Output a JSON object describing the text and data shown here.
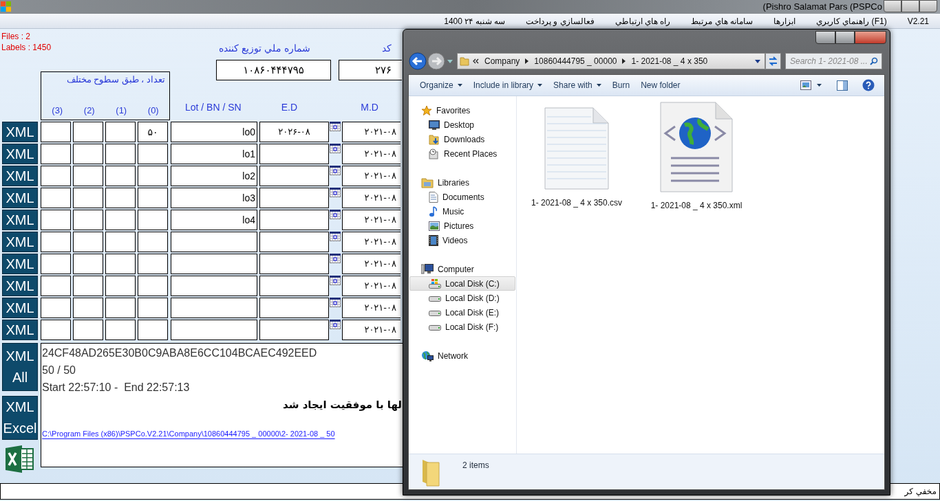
{
  "app": {
    "title": "(Pishro Salamat Pars (PSPCo",
    "menu": [
      "V2.21",
      "(F1) راهنماي كاربري",
      "ابزارها",
      "سامانه هاي مرتبط",
      "راه هاي ارتباطي",
      "فعالسازي و پرداخت",
      "سه شنبه ۲۴ 1400"
    ],
    "stats": [
      "Files : 2",
      "Labels : 1450"
    ],
    "distributor_label": "شماره ملي توزيع كننده",
    "code_label": "كد",
    "distributor_id": "۱۰۸۶۰۴۴۴۷۹۵",
    "code": "۲۷۶",
    "levels_caption": "تعداد ، طبق سطوح مختلف",
    "level_headers": [
      "(3)",
      "(2)",
      "(1)",
      "(0)"
    ],
    "columns": [
      "Lot / BN / SN",
      "E.D",
      "M.D"
    ],
    "rows": [
      {
        "button": "XML",
        "count_0": "۵۰",
        "lot": "lo0",
        "ed": "۲۰۲۶-۰۸",
        "md": "۲۰۲۱-۰۸"
      },
      {
        "button": "XML",
        "lot": "lo1",
        "md": "۲۰۲۱-۰۸"
      },
      {
        "button": "XML",
        "lot": "lo2",
        "md": "۲۰۲۱-۰۸"
      },
      {
        "button": "XML",
        "lot": "lo3",
        "md": "۲۰۲۱-۰۸"
      },
      {
        "button": "XML",
        "lot": "lo4",
        "md": "۲۰۲۱-۰۸"
      },
      {
        "button": "XML",
        "md": "۲۰۲۱-۰۸"
      },
      {
        "button": "XML",
        "md": "۲۰۲۱-۰۸"
      },
      {
        "button": "XML",
        "md": "۲۰۲۱-۰۸"
      },
      {
        "button": "XML",
        "md": "۲۰۲۱-۰۸"
      },
      {
        "button": "XML",
        "md": "۲۰۲۱-۰۸"
      }
    ],
    "side_buttons": [
      "XML All",
      "XML Excel"
    ],
    "output": {
      "lines": [
        "24CF48AD265E30B0C9ABA8E6CC104BCAEC492EED",
        "50 / 50",
        "Start 22:57:10 -  End 22:57:13"
      ],
      "message": "لها با موفقيت ايجاد شد",
      "link": "C:\\Program Files (x86)\\PSPCo.V2.21\\Company\\10860444795 _ 00000\\2- 2021-08 _ 50"
    },
    "status_bar": "مخفي كر"
  },
  "explorer": {
    "address": [
      "Company",
      "10860444795 _ 00000",
      "1- 2021-08 _ 4 x 350"
    ],
    "search_placeholder": "Search 1- 2021-08 ...",
    "toolbar": [
      {
        "label": "Organize",
        "menu": true
      },
      {
        "label": "Include in library",
        "menu": true
      },
      {
        "label": "Share with",
        "menu": true
      },
      {
        "label": "Burn",
        "menu": false
      },
      {
        "label": "New folder",
        "menu": false
      }
    ],
    "nav": [
      {
        "label": "Favorites",
        "selected": false,
        "children": [
          {
            "label": "Desktop",
            "selected": false
          },
          {
            "label": "Downloads",
            "selected": false
          },
          {
            "label": "Recent Places",
            "selected": false
          }
        ]
      },
      {
        "label": "Libraries",
        "selected": false,
        "children": [
          {
            "label": "Documents",
            "selected": false
          },
          {
            "label": "Music",
            "selected": false
          },
          {
            "label": "Pictures",
            "selected": false
          },
          {
            "label": "Videos",
            "selected": false
          }
        ]
      },
      {
        "label": "Computer",
        "selected": false,
        "children": [
          {
            "label": "Local Disk (C:)",
            "selected": true
          },
          {
            "label": "Local Disk (D:)",
            "selected": false
          },
          {
            "label": "Local Disk (E:)",
            "selected": false
          },
          {
            "label": "Local Disk (F:)",
            "selected": false
          }
        ]
      },
      {
        "label": "Network",
        "selected": false
      }
    ],
    "files": [
      {
        "name": "1- 2021-08 _ 4 x 350.csv",
        "kind": "text"
      },
      {
        "name": "1- 2021-08 _ 4 x 350.xml",
        "kind": "xml"
      }
    ],
    "status": "2 items"
  }
}
